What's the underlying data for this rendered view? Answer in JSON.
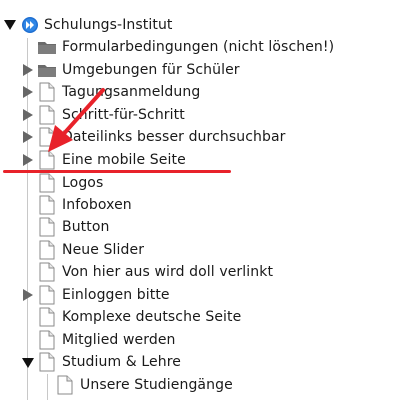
{
  "tree": {
    "root": {
      "label": "Schulungs-Institut",
      "expanded": true,
      "icon": "site-root-globe-icon"
    },
    "items": [
      {
        "label": "Formularbedingungen (nicht löschen!)",
        "icon": "folder-icon",
        "has_children": false
      },
      {
        "label": "Umgebungen für Schüler",
        "icon": "folder-icon",
        "has_children": true,
        "expanded": false
      },
      {
        "label": "Tagungsanmeldung",
        "icon": "page-icon",
        "has_children": true,
        "expanded": false
      },
      {
        "label": "Schritt-für-Schritt",
        "icon": "page-icon",
        "has_children": true,
        "expanded": false
      },
      {
        "label": "Dateilinks besser durchsuchbar",
        "icon": "page-icon",
        "has_children": true,
        "expanded": false
      },
      {
        "label": "Eine mobile Seite",
        "icon": "page-icon",
        "has_children": true,
        "expanded": false,
        "highlighted": true
      },
      {
        "label": "Logos",
        "icon": "page-icon",
        "has_children": false
      },
      {
        "label": "Infoboxen",
        "icon": "page-icon",
        "has_children": false
      },
      {
        "label": "Button",
        "icon": "page-icon",
        "has_children": false
      },
      {
        "label": "Neue Slider",
        "icon": "page-icon",
        "has_children": false
      },
      {
        "label": "Von hier aus wird doll verlinkt",
        "icon": "page-icon",
        "has_children": false
      },
      {
        "label": "Einloggen bitte",
        "icon": "page-icon",
        "has_children": true,
        "expanded": false
      },
      {
        "label": "Komplexe deutsche Seite",
        "icon": "page-icon",
        "has_children": false
      },
      {
        "label": "Mitglied werden",
        "icon": "page-icon",
        "has_children": false
      },
      {
        "label": "Studium & Lehre",
        "icon": "page-icon",
        "has_children": true,
        "expanded": true
      },
      {
        "label": "Unsere Studiengänge",
        "icon": "page-icon",
        "has_children": false,
        "child": true
      }
    ]
  },
  "annotation": {
    "arrow_color": "#e8222a",
    "underline_color": "#e8222a"
  }
}
